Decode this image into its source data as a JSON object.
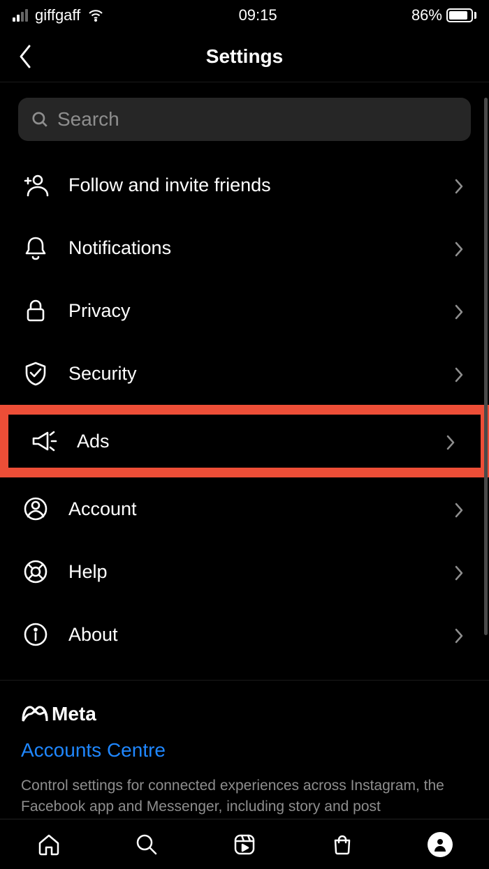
{
  "status": {
    "carrier": "giffgaff",
    "time": "09:15",
    "battery_pct": "86%",
    "battery_fill": 86
  },
  "header": {
    "title": "Settings"
  },
  "search": {
    "placeholder": "Search"
  },
  "rows": [
    {
      "icon": "follow-invite-icon",
      "label": "Follow and invite friends"
    },
    {
      "icon": "notifications-icon",
      "label": "Notifications"
    },
    {
      "icon": "privacy-icon",
      "label": "Privacy"
    },
    {
      "icon": "security-icon",
      "label": "Security"
    },
    {
      "icon": "ads-icon",
      "label": "Ads",
      "highlighted": true
    },
    {
      "icon": "account-icon",
      "label": "Account"
    },
    {
      "icon": "help-icon",
      "label": "Help"
    },
    {
      "icon": "about-icon",
      "label": "About"
    }
  ],
  "meta": {
    "brand": "Meta",
    "link": "Accounts Centre",
    "description": "Control settings for connected experiences across Instagram, the Facebook app and Messenger, including story and post"
  }
}
